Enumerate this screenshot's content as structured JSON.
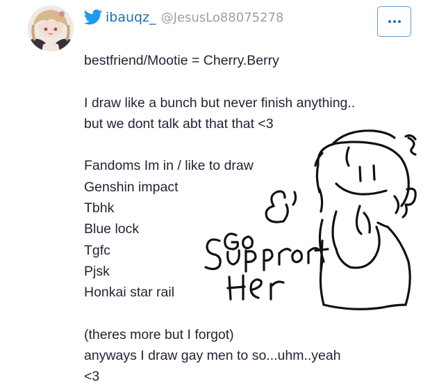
{
  "profile": {
    "display_name": "ibauqz_",
    "handle": "@JesusLo88075278",
    "avatar_icon": "avatar-image",
    "platform_icon": "twitter-bird-icon",
    "accent_color": "#1d6fb5"
  },
  "menu": {
    "icon": "more-horizontal-icon"
  },
  "bio": {
    "lines": [
      "bestfriend/Mootie = Cherry.Berry",
      "",
      "I draw like a bunch but never finish anything..",
      "but we dont talk abt that that <3",
      "",
      "Fandoms Im in / like to draw",
      "Genshin impact",
      "Tbhk",
      "Blue lock",
      "Tgfc",
      "Pjsk",
      "Honkai star rail",
      "",
      "(theres more but I forgot)",
      "anyways I draw gay men to so...uhm..yeah",
      "<3"
    ]
  },
  "doodle": {
    "text_line1": "Go",
    "text_line2": "Support",
    "text_line3": "Her"
  }
}
